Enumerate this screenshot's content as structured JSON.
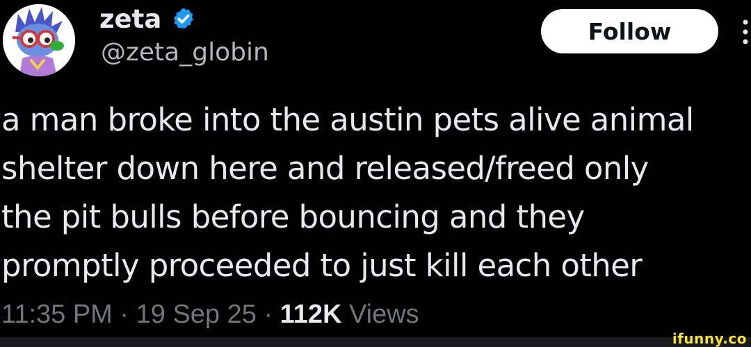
{
  "author": {
    "display_name": "zeta",
    "handle": "@zeta_globin",
    "avatar_icon": "blue-cartoon-character-avatar",
    "verified_icon": "verified-badge-icon"
  },
  "follow_label": "Follow",
  "tweet": {
    "lines": [
      "a man broke into the austin pets alive animal",
      "shelter down here and released/freed only",
      "the pit bulls before bouncing and they",
      "promptly proceeded to just kill each other"
    ]
  },
  "meta": {
    "time": "11:35 PM",
    "separator": " · ",
    "date": "19 Sep 25",
    "views_count": "112K",
    "views_label": " Views"
  },
  "watermark": "ifunny.co",
  "colors": {
    "background": "#000000",
    "text": "#e7e9ea",
    "secondary_text": "#71767b",
    "verified_blue": "#1d9bf0",
    "follow_bg": "#ffffff",
    "watermark": "#f7e03a"
  }
}
